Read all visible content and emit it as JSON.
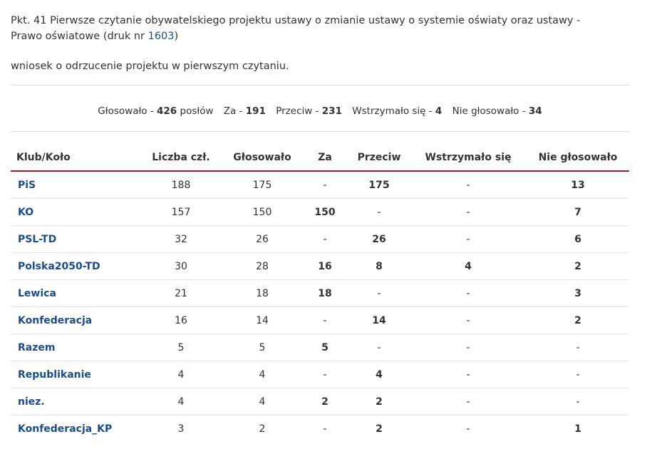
{
  "item": {
    "title_prefix": "Pkt. 41 Pierwsze czytanie obywatelskiego projektu ustawy o zmianie ustawy o systemie oświaty oraz ustawy - Prawo oświatowe (druk nr ",
    "druk_link": "1603",
    "title_suffix": ")",
    "motion": "wniosek o odrzucenie projektu w pierwszym czytaniu."
  },
  "summary": {
    "voted_label": "Głosowało - ",
    "voted_value": "426",
    "voted_unit": " posłów",
    "za_label": "Za - ",
    "za_value": "191",
    "przeciw_label": "Przeciw - ",
    "przeciw_value": "231",
    "wstrzymalo_label": "Wstrzymało się - ",
    "wstrzymalo_value": "4",
    "nie_glosowalo_label": "Nie głosowało - ",
    "nie_glosowalo_value": "34"
  },
  "table": {
    "headers": [
      "Klub/Koło",
      "Liczba czł.",
      "Głosowało",
      "Za",
      "Przeciw",
      "Wstrzymało się",
      "Nie głosowało"
    ],
    "rows": [
      [
        "PiS",
        "188",
        "175",
        "-",
        "175",
        "-",
        "13"
      ],
      [
        "KO",
        "157",
        "150",
        "150",
        "-",
        "-",
        "7"
      ],
      [
        "PSL-TD",
        "32",
        "26",
        "-",
        "26",
        "-",
        "6"
      ],
      [
        "Polska2050-TD",
        "30",
        "28",
        "16",
        "8",
        "4",
        "2"
      ],
      [
        "Lewica",
        "21",
        "18",
        "18",
        "-",
        "-",
        "3"
      ],
      [
        "Konfederacja",
        "16",
        "14",
        "-",
        "14",
        "-",
        "2"
      ],
      [
        "Razem",
        "5",
        "5",
        "5",
        "-",
        "-",
        "-"
      ],
      [
        "Republikanie",
        "4",
        "4",
        "-",
        "4",
        "-",
        "-"
      ],
      [
        "niez.",
        "4",
        "4",
        "2",
        "2",
        "-",
        "-"
      ],
      [
        "Konfederacja_KP",
        "3",
        "2",
        "-",
        "2",
        "-",
        "1"
      ]
    ]
  },
  "colors": {
    "link": "#1a4d8f",
    "header_rule": "#9b1b24"
  }
}
